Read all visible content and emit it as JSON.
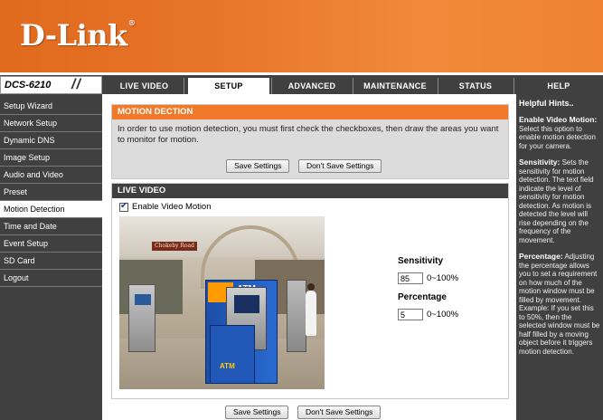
{
  "brand": {
    "logo_text": "D-Link",
    "model": "DCS-6210"
  },
  "nav_tabs": [
    {
      "label": "LIVE VIDEO"
    },
    {
      "label": "SETUP"
    },
    {
      "label": "ADVANCED"
    },
    {
      "label": "MAINTENANCE"
    },
    {
      "label": "STATUS"
    },
    {
      "label": "HELP"
    }
  ],
  "active_tab": "SETUP",
  "sidebar": {
    "items": [
      {
        "label": "Setup Wizard"
      },
      {
        "label": "Network Setup"
      },
      {
        "label": "Dynamic DNS"
      },
      {
        "label": "Image Setup"
      },
      {
        "label": "Audio and Video"
      },
      {
        "label": "Preset"
      },
      {
        "label": "Motion Detection"
      },
      {
        "label": "Time and Date"
      },
      {
        "label": "Event Setup"
      },
      {
        "label": "SD Card"
      },
      {
        "label": "Logout"
      }
    ],
    "active": "Motion Detection"
  },
  "motion_section": {
    "title": "MOTION DECTION",
    "description": "In order to use motion detection, you must first check the checkboxes, then draw the areas you want to monitor for motion.",
    "save_label": "Save Settings",
    "dont_save_label": "Don't Save Settings"
  },
  "live_video": {
    "title": "LIVE VIDEO",
    "enable_label": "Enable Video Motion",
    "enable_checked": true,
    "scene_sign": "Chokeby Road",
    "scene_atm": "ATM",
    "sensitivity_label": "Sensitivity",
    "sensitivity_value": "85",
    "sensitivity_range": "0~100%",
    "percentage_label": "Percentage",
    "percentage_value": "5",
    "percentage_range": "0~100%"
  },
  "bottom_buttons": {
    "save_label": "Save Settings",
    "dont_save_label": "Don't Save Settings"
  },
  "help": {
    "title": "Helpful Hints..",
    "hints": [
      {
        "heading": "Enable Video Motion:",
        "text": "Select this option to enable motion detection for your camera."
      },
      {
        "heading": "Sensitivity:",
        "text": "Sets the sensitivity for motion detection. The text field indicate the level of sensitivity for motion detection. As motion is detected the level will rise depending on the frequency of the movement."
      },
      {
        "heading": "Percentage:",
        "text": "Adjusting the percentage allows you to set a requirement on how much of the motion window must be filled by movement. Example: If you set this to 50%, then the selected window must be half filled by a moving object before it triggers motion detection."
      }
    ]
  },
  "colors": {
    "banner_orange": "#e8742a",
    "section_orange": "#f07a2a",
    "nav_dark": "#404040",
    "panel_gray": "#dcdcdc"
  }
}
